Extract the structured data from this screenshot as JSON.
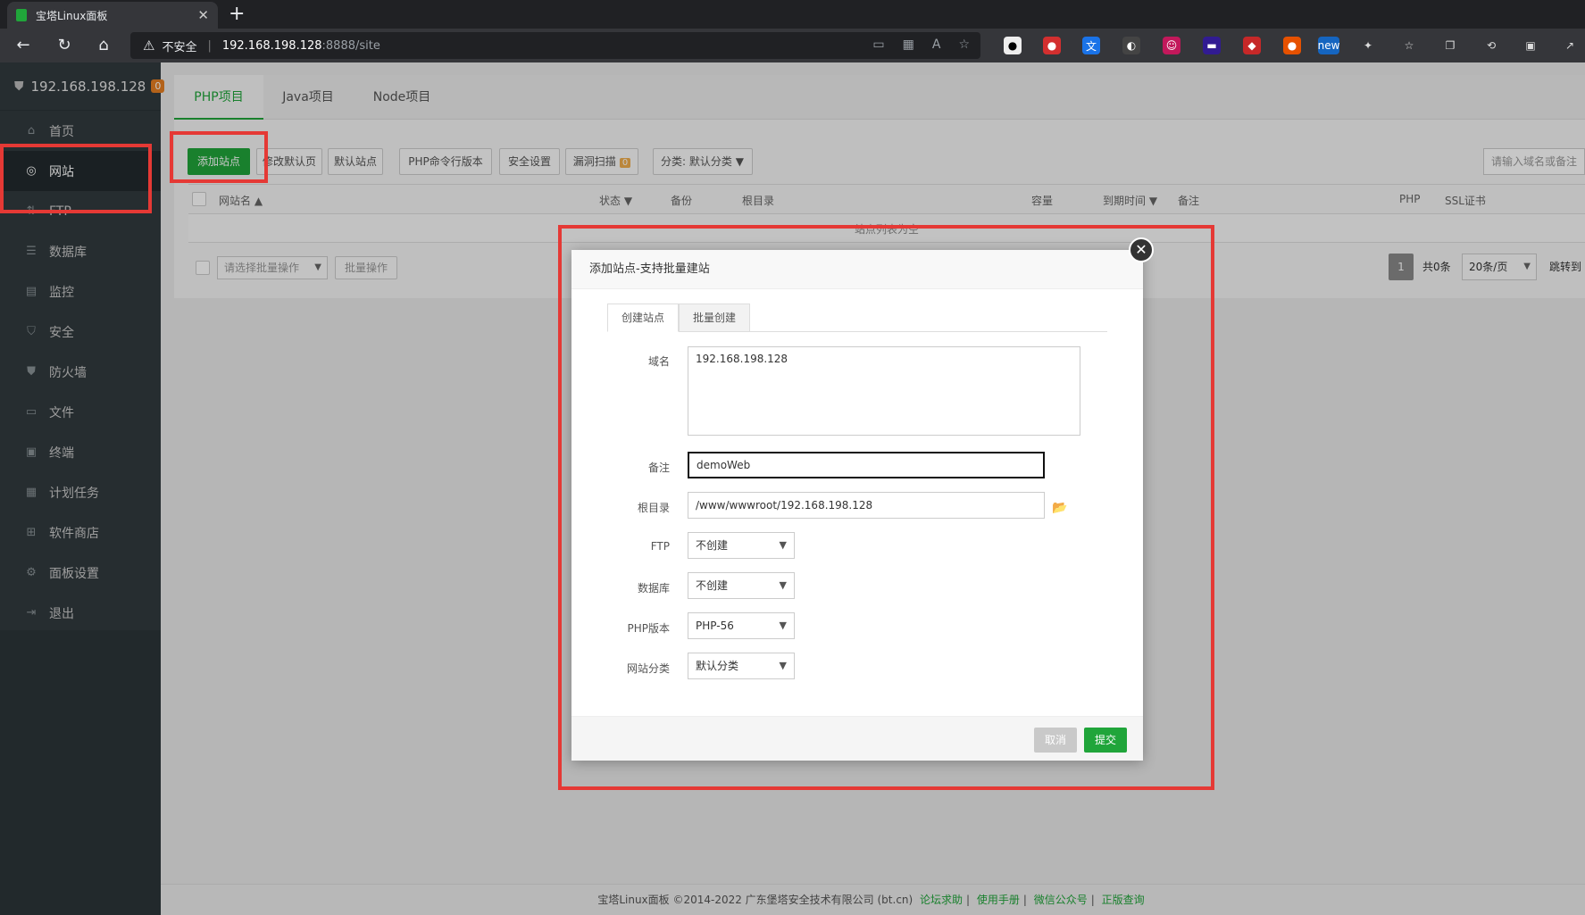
{
  "browser": {
    "tab_title": "宝塔Linux面板",
    "url_warning": "不安全",
    "url_host": "192.168.198.128",
    "url_path": ":8888/site"
  },
  "sidebar": {
    "host": "192.168.198.128",
    "badge": "0",
    "items": [
      {
        "label": "首页",
        "icon": "home-icon"
      },
      {
        "label": "网站",
        "icon": "globe-icon"
      },
      {
        "label": "FTP",
        "icon": "ftp-icon"
      },
      {
        "label": "数据库",
        "icon": "database-icon"
      },
      {
        "label": "监控",
        "icon": "monitor-icon"
      },
      {
        "label": "安全",
        "icon": "shield-icon"
      },
      {
        "label": "防火墙",
        "icon": "firewall-icon"
      },
      {
        "label": "文件",
        "icon": "folder-icon"
      },
      {
        "label": "终端",
        "icon": "terminal-icon"
      },
      {
        "label": "计划任务",
        "icon": "calendar-icon"
      },
      {
        "label": "软件商店",
        "icon": "grid-icon"
      },
      {
        "label": "面板设置",
        "icon": "gear-icon"
      },
      {
        "label": "退出",
        "icon": "logout-icon"
      }
    ]
  },
  "project_tabs": [
    "PHP项目",
    "Java项目",
    "Node项目"
  ],
  "toolbar": {
    "add_site": "添加站点",
    "modify_default": "修改默认页",
    "default_site": "默认站点",
    "php_cli": "PHP命令行版本",
    "security": "安全设置",
    "vuln_scan": "漏洞扫描",
    "vuln_count": "0",
    "category": "分类: 默认分类",
    "search_placeholder": "请输入域名或备注"
  },
  "table": {
    "headers": {
      "name": "网站名",
      "status": "状态",
      "backup": "备份",
      "root": "根目录",
      "capacity": "容量",
      "expire": "到期时间",
      "remark": "备注",
      "php": "PHP",
      "ssl": "SSL证书"
    },
    "empty_text": "站点列表为空"
  },
  "bulk": {
    "select_placeholder": "请选择批量操作",
    "button": "批量操作"
  },
  "pagination": {
    "page": "1",
    "total": "共0条",
    "per_page": "20条/页",
    "jump": "跳转到"
  },
  "modal": {
    "title": "添加站点-支持批量建站",
    "tabs": [
      "创建站点",
      "批量创建"
    ],
    "fields": {
      "domain_label": "域名",
      "domain_value": "192.168.198.128",
      "remark_label": "备注",
      "remark_value": "demoWeb",
      "root_label": "根目录",
      "root_value": "/www/wwwroot/192.168.198.128",
      "ftp_label": "FTP",
      "ftp_value": "不创建",
      "db_label": "数据库",
      "db_value": "不创建",
      "php_label": "PHP版本",
      "php_value": "PHP-56",
      "category_label": "网站分类",
      "category_value": "默认分类"
    },
    "cancel": "取消",
    "submit": "提交"
  },
  "footer": {
    "copyright": "宝塔Linux面板 ©2014-2022 广东堡塔安全技术有限公司 (bt.cn)",
    "links": [
      "论坛求助",
      "使用手册",
      "微信公众号",
      "正版查询"
    ]
  },
  "colors": {
    "brand_green": "#20a53a",
    "highlight_red": "#e53935",
    "sidebar_bg": "#313a3e"
  }
}
